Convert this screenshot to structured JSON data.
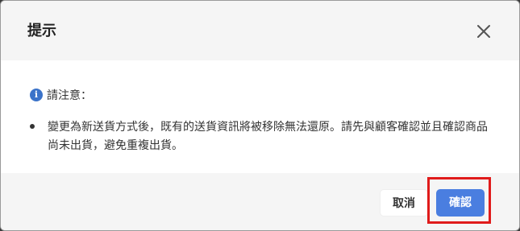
{
  "dialog": {
    "title": "提示",
    "close_icon": "close-icon",
    "notice": {
      "icon": "info-icon",
      "icon_glyph": "i",
      "label": "請注意："
    },
    "items": [
      "變更為新送貨方式後，既有的送貨資訊將被移除無法還原。請先與顧客確認並且確認商品尚未出貨，避免重複出貨。"
    ],
    "buttons": {
      "cancel_label": "取消",
      "confirm_label": "確認"
    }
  },
  "colors": {
    "primary": "#4a7ee0",
    "info_icon": "#3b73c9",
    "highlight": "#e01b1b"
  }
}
